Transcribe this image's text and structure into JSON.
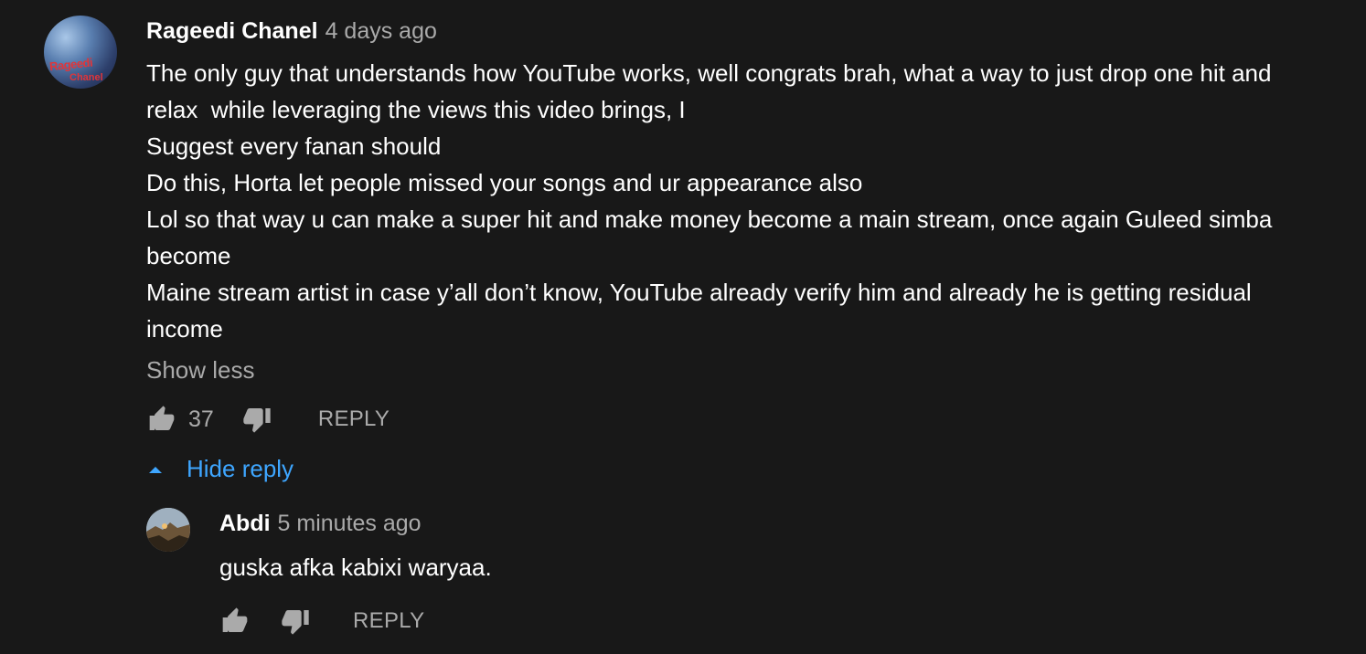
{
  "comment": {
    "author": "Rageedi Chanel",
    "time": "4 days ago",
    "avatar_text_1": "Rageedi",
    "avatar_text_2": "Chanel",
    "lines": [
      "The only guy that understands how YouTube works, well congrats brah, what a way to just drop one hit and",
      "relax  while leveraging the views this video brings, I",
      "Suggest every fanan should",
      "Do this, Horta let people missed your songs and ur appearance also",
      "Lol so that way u can make a super hit and make money become a main stream, once again Guleed simba",
      "become",
      "Maine stream artist in case y’all don’t know, YouTube already verify him and already he is getting residual",
      "income"
    ],
    "show_less": "Show less",
    "likes": "37",
    "reply_label": "REPLY"
  },
  "hide_reply_label": "Hide reply",
  "reply": {
    "author": "Abdi",
    "time": "5 minutes ago",
    "text": "guska afka kabixi waryaa.",
    "reply_label": "REPLY"
  },
  "colors": {
    "background": "#181818",
    "text_primary": "#ffffff",
    "text_secondary": "#aaaaaa",
    "link": "#3ea6ff"
  },
  "icons": [
    "thumbs-up-icon",
    "thumbs-down-icon",
    "caret-up-icon"
  ]
}
